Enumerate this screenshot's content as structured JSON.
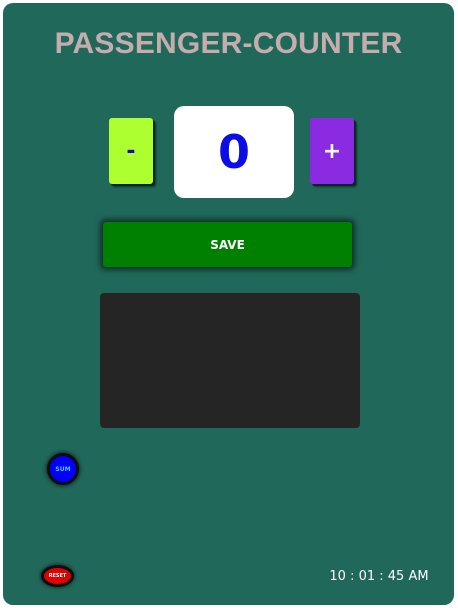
{
  "app": {
    "title": "PASSENGER-COUNTER"
  },
  "counter": {
    "decrement_label": "-",
    "value": "0",
    "increment_label": "+"
  },
  "actions": {
    "save_label": "SAVE",
    "sum_label": "SUM",
    "reset_label": "RESET"
  },
  "status": {
    "time": "10 : 01 : 45 AM"
  },
  "colors": {
    "background": "#20695a",
    "title": "#c5adad",
    "decrement": "#adff2f",
    "increment": "#8a2be2",
    "count_text": "#0c0ce6",
    "save": "#008000",
    "log_panel": "#252525",
    "sum": "#0000ff",
    "reset": "#e10000"
  }
}
